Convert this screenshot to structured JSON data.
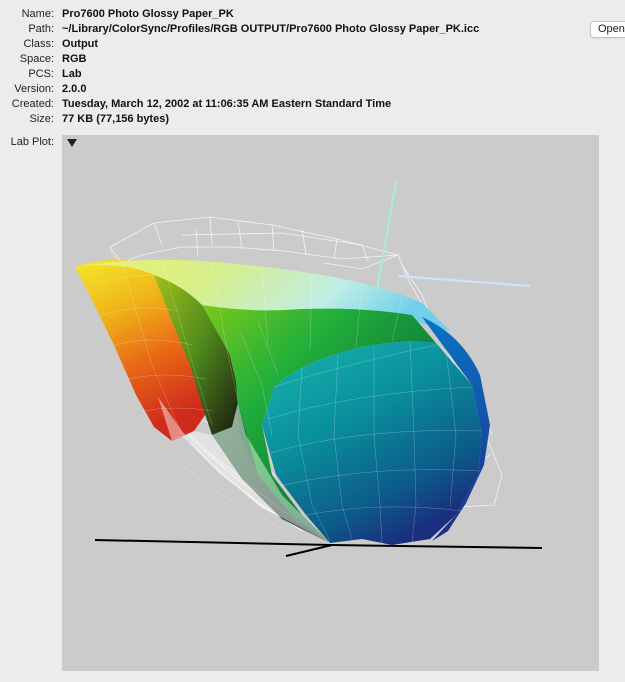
{
  "info": [
    {
      "key": "name",
      "label": "Name:",
      "value": "Pro7600 Photo Glossy Paper_PK"
    },
    {
      "key": "path",
      "label": "Path:",
      "value": "~/Library/ColorSync/Profiles/RGB OUTPUT/Pro7600 Photo Glossy Paper_PK.icc"
    },
    {
      "key": "class",
      "label": "Class:",
      "value": "Output"
    },
    {
      "key": "space",
      "label": "Space:",
      "value": "RGB"
    },
    {
      "key": "pcs",
      "label": "PCS:",
      "value": "Lab"
    },
    {
      "key": "version",
      "label": "Version:",
      "value": "2.0.0"
    },
    {
      "key": "created",
      "label": "Created:",
      "value": "Tuesday, March 12, 2002 at 11:06:35 AM Eastern Standard Time"
    },
    {
      "key": "size",
      "label": "Size:",
      "value": "77 KB (77,156 bytes)"
    }
  ],
  "open_button_label": "Open",
  "plot": {
    "label": "Lab Plot:",
    "disclosure_icon": "triangle-down-icon",
    "background_color": "#cbcbcb"
  }
}
